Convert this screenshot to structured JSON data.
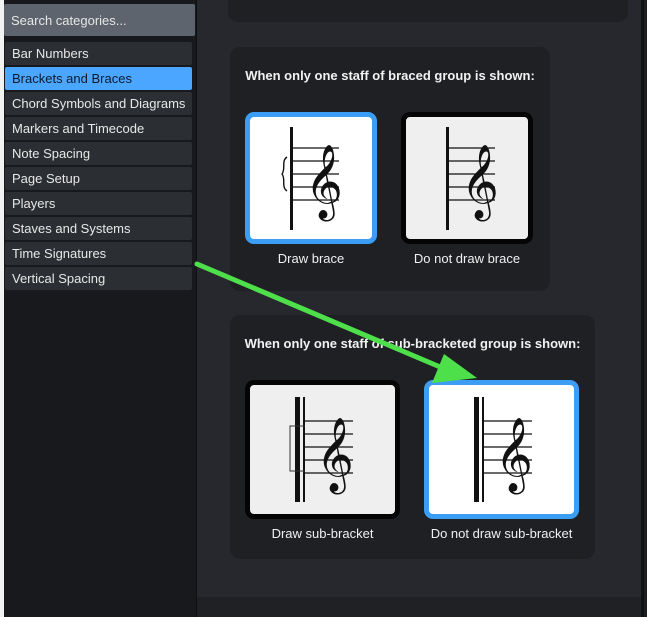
{
  "search": {
    "placeholder": "Search categories..."
  },
  "categories": [
    {
      "label": "Bar Numbers"
    },
    {
      "label": "Brackets and Braces",
      "active": true
    },
    {
      "label": "Chord Symbols and Diagrams"
    },
    {
      "label": "Markers and Timecode"
    },
    {
      "label": "Note Spacing"
    },
    {
      "label": "Page Setup"
    },
    {
      "label": "Players"
    },
    {
      "label": "Staves and Systems"
    },
    {
      "label": "Time Signatures"
    },
    {
      "label": "Vertical Spacing"
    }
  ],
  "brace_group": {
    "title": "When only one staff of braced group is shown:",
    "options": [
      {
        "label": "Draw brace",
        "selected": true
      },
      {
        "label": "Do not draw brace",
        "selected": false
      }
    ]
  },
  "bracket_group": {
    "title": "When only one staff of sub-bracketed group is shown:",
    "options": [
      {
        "label": "Draw sub-bracket",
        "selected": false
      },
      {
        "label": "Do not draw sub-bracket",
        "selected": true
      }
    ]
  },
  "colors": {
    "accent": "#3b9df4",
    "selected_category": "#4aa6ff",
    "arrow": "#4ee04a"
  },
  "icons": {
    "clef": "treble-clef-icon",
    "brace": "brace-icon",
    "bracket": "sub-bracket-icon"
  }
}
